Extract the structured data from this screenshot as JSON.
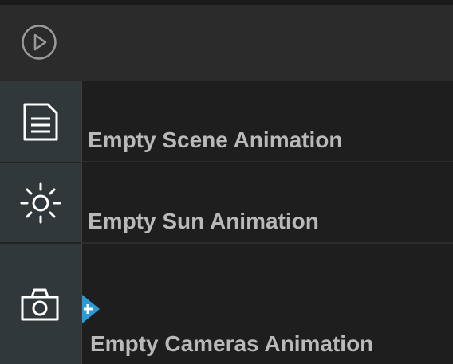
{
  "header": {
    "play_icon": "play-circle-icon"
  },
  "sidebar": {
    "items": [
      {
        "icon": "document-icon",
        "label": "Scene"
      },
      {
        "icon": "sun-icon",
        "label": "Sun"
      },
      {
        "icon": "camera-icon",
        "label": "Cameras"
      }
    ]
  },
  "tracks": [
    {
      "label": "Empty Scene Animation"
    },
    {
      "label": "Empty Sun Animation"
    },
    {
      "label": "Empty Cameras Animation",
      "add_handle_icon": "add-keyframe-icon"
    }
  ],
  "colors": {
    "background": "#1e1e1e",
    "header": "#2b2b2b",
    "sidebar": "#31383b",
    "label_text": "#b9b9b9",
    "icon_stroke": "#ffffff",
    "accent": "#2a9ad9"
  }
}
